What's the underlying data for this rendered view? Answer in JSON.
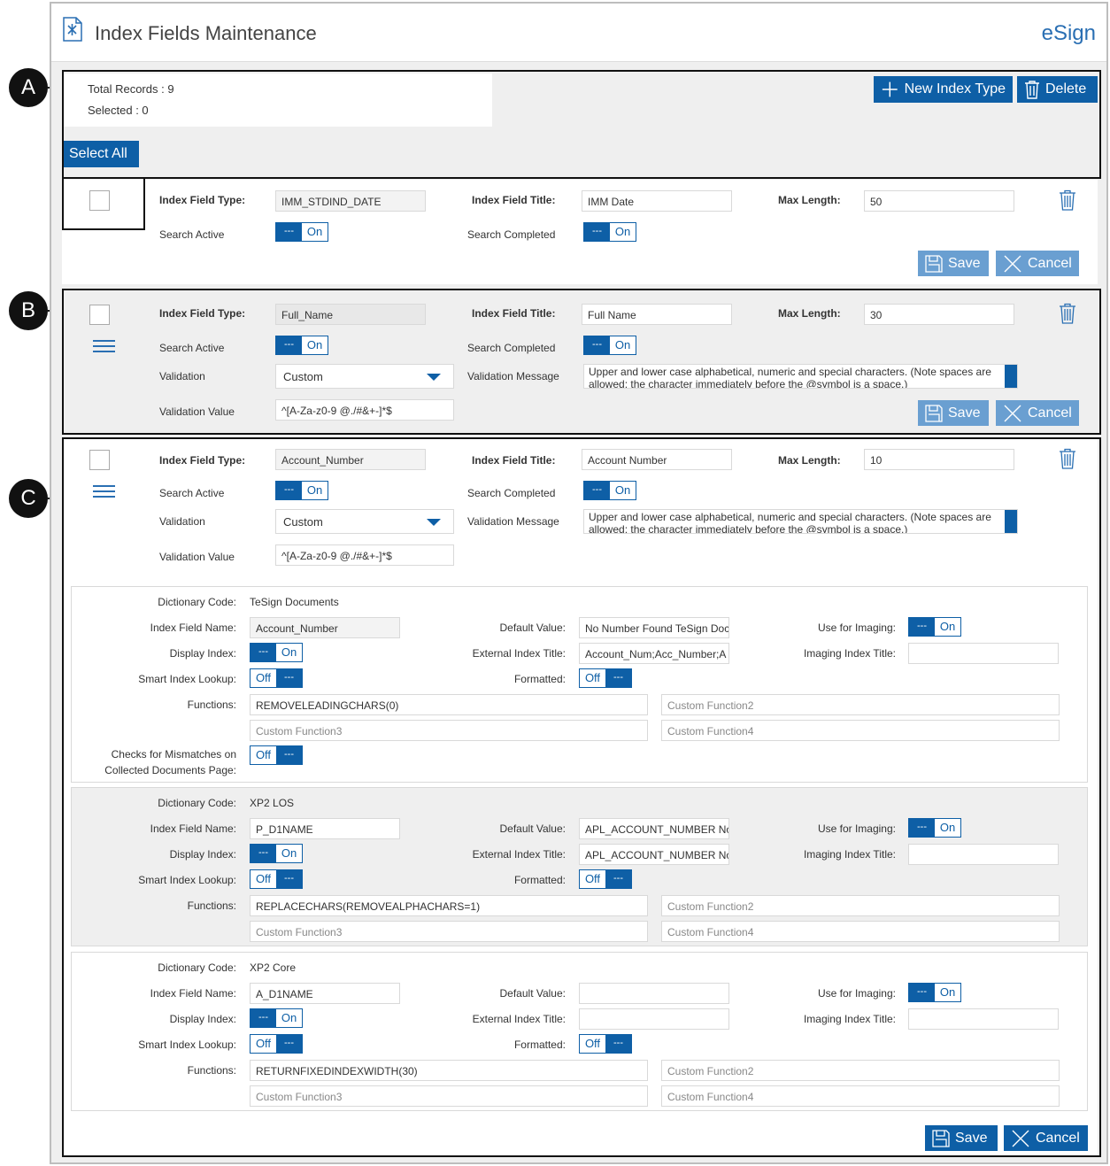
{
  "header": {
    "title": "Index Fields Maintenance",
    "brand": "eSign"
  },
  "callouts": [
    "A",
    "B",
    "C"
  ],
  "toolbar": {
    "total_records": "Total Records : 9",
    "selected": "Selected : 0",
    "new_index_type": "New Index Type",
    "delete": "Delete",
    "select_all": "Select All"
  },
  "labels": {
    "index_field_type": "Index Field Type:",
    "index_field_title": "Index Field Title:",
    "max_length": "Max Length:",
    "search_active": "Search Active",
    "search_completed": "Search Completed",
    "validation": "Validation",
    "validation_message": "Validation Message",
    "validation_value": "Validation Value",
    "save": "Save",
    "cancel": "Cancel",
    "on": "On",
    "off": "Off",
    "knob": "---",
    "dictionary_code": "Dictionary Code:",
    "index_field_name": "Index Field Name:",
    "display_index": "Display Index:",
    "smart_index_lookup": "Smart Index Lookup:",
    "functions": "Functions:",
    "checks_mismatch_1": "Checks for Mismatches on",
    "checks_mismatch_2": "Collected Documents Page:",
    "default_value": "Default Value:",
    "external_index_title": "External Index Title:",
    "formatted": "Formatted:",
    "use_for_imaging": "Use for Imaging:",
    "imaging_index_title": "Imaging Index Title:"
  },
  "records": [
    {
      "type": "IMM_STDIND_DATE",
      "title": "IMM Date",
      "max_length": "50"
    },
    {
      "type": "Full_Name",
      "title": "Full Name",
      "max_length": "30",
      "validation": "Custom",
      "validation_message": "Upper and lower case alphabetical, numeric and special characters. (Note spaces are allowed; the character immediately before the @symbol  is a space.)",
      "validation_value": "^[A-Za-z0-9 @./#&+-]*$"
    },
    {
      "type": "Account_Number",
      "title": "Account Number",
      "max_length": "10",
      "validation": "Custom",
      "validation_message": "Upper and lower case alphabetical, numeric and special characters. (Note spaces are allowed; the character immediately before the @symbol  is a space.)",
      "validation_value": "^[A-Za-z0-9 @./#&+-]*$"
    }
  ],
  "dictionaries": [
    {
      "code": "TeSign Documents",
      "field_name": "Account_Number",
      "default_value": "No Number Found TeSign Doc",
      "external_title": "Account_Num;Acc_Number;A",
      "imaging_title": "",
      "function1": "REMOVELEADINGCHARS(0)",
      "function2": "Custom Function2",
      "function3": "Custom Function3",
      "function4": "Custom Function4"
    },
    {
      "code": "XP2 LOS",
      "field_name": "P_D1NAME",
      "default_value": "APL_ACCOUNT_NUMBER Not",
      "external_title": "APL_ACCOUNT_NUMBER Not",
      "imaging_title": "",
      "function1": "REPLACECHARS(REMOVEALPHACHARS=1)",
      "function2": "Custom Function2",
      "function3": "Custom Function3",
      "function4": "Custom Function4"
    },
    {
      "code": "XP2 Core",
      "field_name": "A_D1NAME",
      "default_value": "",
      "external_title": "",
      "imaging_title": "",
      "function1": "RETURNFIXEDINDEXWIDTH(30)",
      "function2": "Custom Function2",
      "function3": "Custom Function3",
      "function4": "Custom Function4"
    }
  ]
}
